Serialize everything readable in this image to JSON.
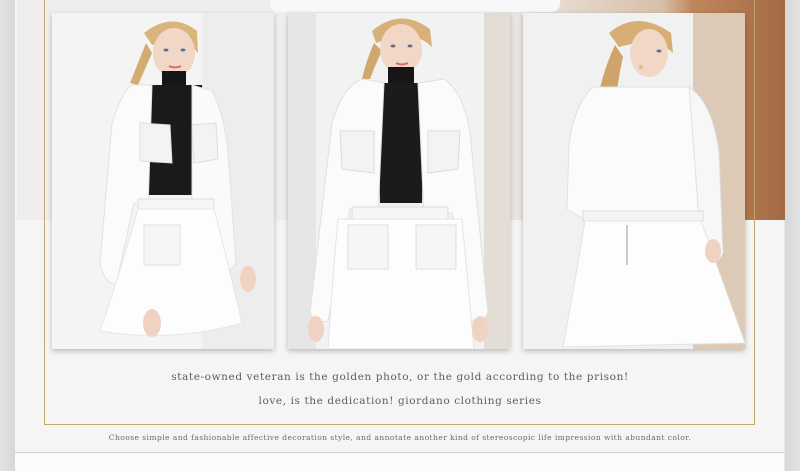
{
  "captions": {
    "line1": "state-owned veteran is the golden photo, or the gold according to the prison!",
    "line2": "love, is the dedication! giordano clothing series"
  },
  "footer": {
    "note": "Choose simple and fashionable affective decoration style, and annotate another kind of stereoscopic life impression with abundant color."
  },
  "colors": {
    "frame": "#c6a46a",
    "page": "#f5f5f5",
    "text": "#5d5d5d"
  }
}
